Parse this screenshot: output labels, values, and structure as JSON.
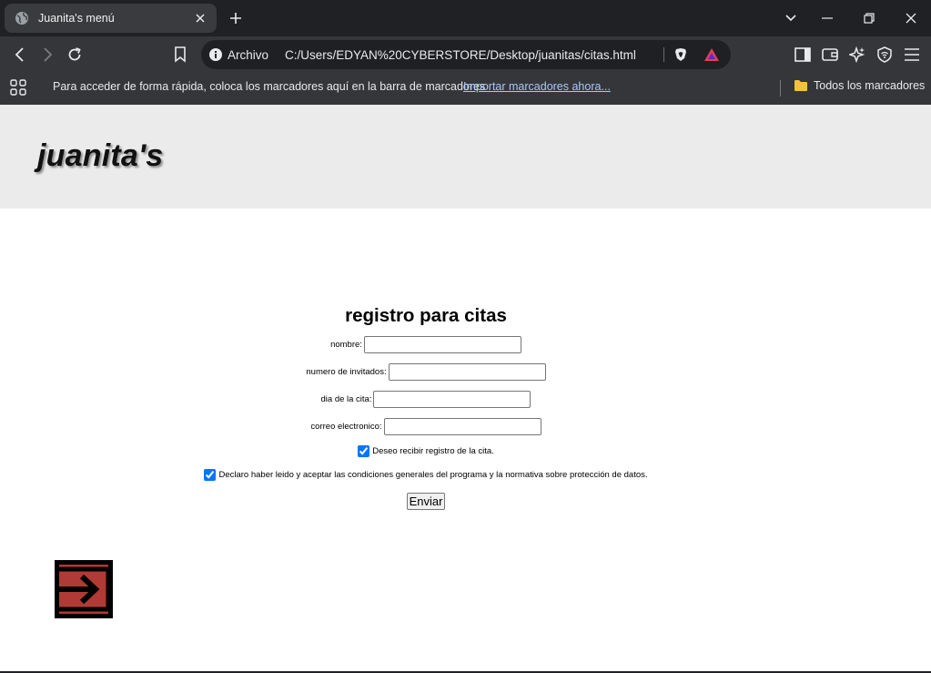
{
  "browser": {
    "tab_title": "Juanita's menú",
    "address_scheme": "Archivo",
    "address_url": "C:/Users/EDYAN%20CYBERSTORE/Desktop/juanitas/citas.html",
    "bookmarks_hint": "Para acceder de forma rápida, coloca los marcadores aquí en la barra de marcadores",
    "bookmarks_import_link": "Importar marcadores ahora...",
    "all_bookmarks_label": "Todos los marcadores"
  },
  "page": {
    "logo": "juanita's",
    "form": {
      "title": "registro para citas",
      "fields": [
        {
          "label": "nombre:",
          "value": ""
        },
        {
          "label": "numero de invitados:",
          "value": ""
        },
        {
          "label": "dia de la cita:",
          "value": ""
        },
        {
          "label": "correo electronico:",
          "value": ""
        }
      ],
      "checkbox_receipt": {
        "label": "Deseo recibir registro de la cita.",
        "checked": true
      },
      "checkbox_terms": {
        "label": "Declaro haber leido y aceptar las condiciones generales del programa y la normativa sobre protección de datos.",
        "checked": true
      },
      "submit_label": "Enviar"
    },
    "exit_icon": "exit-arrow-icon"
  },
  "colors": {
    "tabbar_bg": "#202124",
    "toolbar_bg": "#35363a",
    "header_bg": "#ebebeb",
    "exit_icon_bg": "#b03a35",
    "link_color": "#a8c7fa"
  }
}
